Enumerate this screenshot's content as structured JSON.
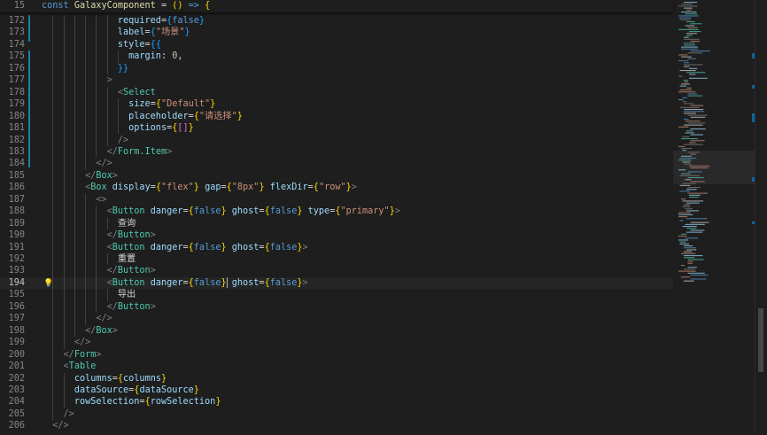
{
  "sticky": {
    "line_number": "15",
    "tokens": [
      {
        "t": "const ",
        "c": "t-kw"
      },
      {
        "t": "GalaxyComponent",
        "c": "t-fn"
      },
      {
        "t": " = ",
        "c": "t-txt"
      },
      {
        "t": "()",
        "c": "t-br1"
      },
      {
        "t": " ",
        "c": "t-txt"
      },
      {
        "t": "=>",
        "c": "t-kw"
      },
      {
        "t": " ",
        "c": "t-txt"
      },
      {
        "t": "{",
        "c": "t-br1"
      }
    ]
  },
  "editor": {
    "active_line": "194",
    "lines": [
      {
        "n": "172",
        "tokens": [
          {
            "t": "              ",
            "c": ""
          },
          {
            "t": "required",
            "c": "t-attr"
          },
          {
            "t": "=",
            "c": "t-txt"
          },
          {
            "t": "{",
            "c": "t-br2"
          },
          {
            "t": "false",
            "c": "t-kw"
          },
          {
            "t": "}",
            "c": "t-br2"
          }
        ]
      },
      {
        "n": "173",
        "tokens": [
          {
            "t": "              ",
            "c": ""
          },
          {
            "t": "label",
            "c": "t-attr"
          },
          {
            "t": "=",
            "c": "t-txt"
          },
          {
            "t": "{",
            "c": "t-br2"
          },
          {
            "t": "\"场景\"",
            "c": "t-str"
          },
          {
            "t": "}",
            "c": "t-br2"
          }
        ]
      },
      {
        "n": "174",
        "tokens": [
          {
            "t": "              ",
            "c": ""
          },
          {
            "t": "style",
            "c": "t-attr"
          },
          {
            "t": "=",
            "c": "t-txt"
          },
          {
            "t": "{{",
            "c": "t-br2"
          }
        ]
      },
      {
        "n": "175",
        "tokens": [
          {
            "t": "                ",
            "c": ""
          },
          {
            "t": "margin",
            "c": "t-attr"
          },
          {
            "t": ": ",
            "c": "t-txt"
          },
          {
            "t": "0",
            "c": "t-num"
          },
          {
            "t": ",",
            "c": "t-txt"
          }
        ]
      },
      {
        "n": "176",
        "tokens": [
          {
            "t": "              ",
            "c": ""
          },
          {
            "t": "}}",
            "c": "t-br2"
          }
        ]
      },
      {
        "n": "177",
        "tokens": [
          {
            "t": "            ",
            "c": ""
          },
          {
            "t": ">",
            "c": "t-pun"
          }
        ]
      },
      {
        "n": "178",
        "tokens": [
          {
            "t": "              ",
            "c": ""
          },
          {
            "t": "<",
            "c": "t-pun"
          },
          {
            "t": "Select",
            "c": "t-tag"
          }
        ]
      },
      {
        "n": "179",
        "tokens": [
          {
            "t": "                ",
            "c": ""
          },
          {
            "t": "size",
            "c": "t-attr"
          },
          {
            "t": "=",
            "c": "t-txt"
          },
          {
            "t": "{",
            "c": "t-br1"
          },
          {
            "t": "\"Default\"",
            "c": "t-str"
          },
          {
            "t": "}",
            "c": "t-br1"
          }
        ]
      },
      {
        "n": "180",
        "tokens": [
          {
            "t": "                ",
            "c": ""
          },
          {
            "t": "placeholder",
            "c": "t-attr"
          },
          {
            "t": "=",
            "c": "t-txt"
          },
          {
            "t": "{",
            "c": "t-br1"
          },
          {
            "t": "\"请选择\"",
            "c": "t-str"
          },
          {
            "t": "}",
            "c": "t-br1"
          }
        ]
      },
      {
        "n": "181",
        "tokens": [
          {
            "t": "                ",
            "c": ""
          },
          {
            "t": "options",
            "c": "t-attr"
          },
          {
            "t": "=",
            "c": "t-txt"
          },
          {
            "t": "{",
            "c": "t-br1"
          },
          {
            "t": "[]",
            "c": "t-brk"
          },
          {
            "t": "}",
            "c": "t-br1"
          }
        ]
      },
      {
        "n": "182",
        "tokens": [
          {
            "t": "              ",
            "c": ""
          },
          {
            "t": "/>",
            "c": "t-pun"
          }
        ]
      },
      {
        "n": "183",
        "tokens": [
          {
            "t": "            ",
            "c": ""
          },
          {
            "t": "</",
            "c": "t-pun"
          },
          {
            "t": "Form.Item",
            "c": "t-tag"
          },
          {
            "t": ">",
            "c": "t-pun"
          }
        ]
      },
      {
        "n": "184",
        "tokens": [
          {
            "t": "          ",
            "c": ""
          },
          {
            "t": "</>",
            "c": "t-pun"
          }
        ]
      },
      {
        "n": "185",
        "tokens": [
          {
            "t": "        ",
            "c": ""
          },
          {
            "t": "</",
            "c": "t-pun"
          },
          {
            "t": "Box",
            "c": "t-tag"
          },
          {
            "t": ">",
            "c": "t-pun"
          }
        ]
      },
      {
        "n": "186",
        "tokens": [
          {
            "t": "        ",
            "c": ""
          },
          {
            "t": "<",
            "c": "t-pun"
          },
          {
            "t": "Box",
            "c": "t-tag"
          },
          {
            "t": " ",
            "c": ""
          },
          {
            "t": "display",
            "c": "t-attr"
          },
          {
            "t": "=",
            "c": "t-txt"
          },
          {
            "t": "{",
            "c": "t-br1"
          },
          {
            "t": "\"flex\"",
            "c": "t-str"
          },
          {
            "t": "}",
            "c": "t-br1"
          },
          {
            "t": " ",
            "c": ""
          },
          {
            "t": "gap",
            "c": "t-attr"
          },
          {
            "t": "=",
            "c": "t-txt"
          },
          {
            "t": "{",
            "c": "t-br1"
          },
          {
            "t": "\"8px\"",
            "c": "t-str"
          },
          {
            "t": "}",
            "c": "t-br1"
          },
          {
            "t": " ",
            "c": ""
          },
          {
            "t": "flexDir",
            "c": "t-attr"
          },
          {
            "t": "=",
            "c": "t-txt"
          },
          {
            "t": "{",
            "c": "t-br1"
          },
          {
            "t": "\"row\"",
            "c": "t-str"
          },
          {
            "t": "}",
            "c": "t-br1"
          },
          {
            "t": ">",
            "c": "t-pun"
          }
        ]
      },
      {
        "n": "187",
        "tokens": [
          {
            "t": "          ",
            "c": ""
          },
          {
            "t": "<>",
            "c": "t-pun"
          }
        ]
      },
      {
        "n": "188",
        "tokens": [
          {
            "t": "            ",
            "c": ""
          },
          {
            "t": "<",
            "c": "t-pun"
          },
          {
            "t": "Button",
            "c": "t-tag"
          },
          {
            "t": " ",
            "c": ""
          },
          {
            "t": "danger",
            "c": "t-attr"
          },
          {
            "t": "=",
            "c": "t-txt"
          },
          {
            "t": "{",
            "c": "t-br1"
          },
          {
            "t": "false",
            "c": "t-kw"
          },
          {
            "t": "}",
            "c": "t-br1"
          },
          {
            "t": " ",
            "c": ""
          },
          {
            "t": "ghost",
            "c": "t-attr"
          },
          {
            "t": "=",
            "c": "t-txt"
          },
          {
            "t": "{",
            "c": "t-br1"
          },
          {
            "t": "false",
            "c": "t-kw"
          },
          {
            "t": "}",
            "c": "t-br1"
          },
          {
            "t": " ",
            "c": ""
          },
          {
            "t": "type",
            "c": "t-attr"
          },
          {
            "t": "=",
            "c": "t-txt"
          },
          {
            "t": "{",
            "c": "t-br1"
          },
          {
            "t": "\"primary\"",
            "c": "t-str"
          },
          {
            "t": "}",
            "c": "t-br1"
          },
          {
            "t": ">",
            "c": "t-pun"
          }
        ]
      },
      {
        "n": "189",
        "tokens": [
          {
            "t": "              ",
            "c": ""
          },
          {
            "t": "查询",
            "c": "t-txt"
          }
        ]
      },
      {
        "n": "190",
        "tokens": [
          {
            "t": "            ",
            "c": ""
          },
          {
            "t": "</",
            "c": "t-pun"
          },
          {
            "t": "Button",
            "c": "t-tag"
          },
          {
            "t": ">",
            "c": "t-pun"
          }
        ]
      },
      {
        "n": "191",
        "tokens": [
          {
            "t": "            ",
            "c": ""
          },
          {
            "t": "<",
            "c": "t-pun"
          },
          {
            "t": "Button",
            "c": "t-tag"
          },
          {
            "t": " ",
            "c": ""
          },
          {
            "t": "danger",
            "c": "t-attr"
          },
          {
            "t": "=",
            "c": "t-txt"
          },
          {
            "t": "{",
            "c": "t-br1"
          },
          {
            "t": "false",
            "c": "t-kw"
          },
          {
            "t": "}",
            "c": "t-br1"
          },
          {
            "t": " ",
            "c": ""
          },
          {
            "t": "ghost",
            "c": "t-attr"
          },
          {
            "t": "=",
            "c": "t-txt"
          },
          {
            "t": "{",
            "c": "t-br1"
          },
          {
            "t": "false",
            "c": "t-kw"
          },
          {
            "t": "}",
            "c": "t-br1"
          },
          {
            "t": ">",
            "c": "t-pun"
          }
        ]
      },
      {
        "n": "192",
        "tokens": [
          {
            "t": "              ",
            "c": ""
          },
          {
            "t": "重置",
            "c": "t-txt"
          }
        ]
      },
      {
        "n": "193",
        "tokens": [
          {
            "t": "            ",
            "c": ""
          },
          {
            "t": "</",
            "c": "t-pun"
          },
          {
            "t": "Button",
            "c": "t-tag"
          },
          {
            "t": ">",
            "c": "t-pun"
          }
        ]
      },
      {
        "n": "194",
        "tokens": [
          {
            "t": "            ",
            "c": ""
          },
          {
            "t": "<",
            "c": "t-pun"
          },
          {
            "t": "Button",
            "c": "t-tag"
          },
          {
            "t": " ",
            "c": ""
          },
          {
            "t": "danger",
            "c": "t-attr"
          },
          {
            "t": "=",
            "c": "t-txt"
          },
          {
            "t": "{",
            "c": "t-br1"
          },
          {
            "t": "false",
            "c": "t-kw"
          },
          {
            "t": "}",
            "c": "t-br1",
            "cursor": true
          },
          {
            "t": " ",
            "c": ""
          },
          {
            "t": "ghost",
            "c": "t-attr"
          },
          {
            "t": "=",
            "c": "t-txt"
          },
          {
            "t": "{",
            "c": "t-br1"
          },
          {
            "t": "false",
            "c": "t-kw"
          },
          {
            "t": "}",
            "c": "t-br1"
          },
          {
            "t": ">",
            "c": "t-pun"
          }
        ]
      },
      {
        "n": "195",
        "tokens": [
          {
            "t": "              ",
            "c": ""
          },
          {
            "t": "导出",
            "c": "t-txt"
          }
        ]
      },
      {
        "n": "196",
        "tokens": [
          {
            "t": "            ",
            "c": ""
          },
          {
            "t": "</",
            "c": "t-pun"
          },
          {
            "t": "Button",
            "c": "t-tag"
          },
          {
            "t": ">",
            "c": "t-pun"
          }
        ]
      },
      {
        "n": "197",
        "tokens": [
          {
            "t": "          ",
            "c": ""
          },
          {
            "t": "</>",
            "c": "t-pun"
          }
        ]
      },
      {
        "n": "198",
        "tokens": [
          {
            "t": "        ",
            "c": ""
          },
          {
            "t": "</",
            "c": "t-pun"
          },
          {
            "t": "Box",
            "c": "t-tag"
          },
          {
            "t": ">",
            "c": "t-pun"
          }
        ]
      },
      {
        "n": "199",
        "tokens": [
          {
            "t": "      ",
            "c": ""
          },
          {
            "t": "</>",
            "c": "t-pun"
          }
        ]
      },
      {
        "n": "200",
        "tokens": [
          {
            "t": "    ",
            "c": ""
          },
          {
            "t": "</",
            "c": "t-pun"
          },
          {
            "t": "Form",
            "c": "t-tag"
          },
          {
            "t": ">",
            "c": "t-pun"
          }
        ]
      },
      {
        "n": "201",
        "tokens": [
          {
            "t": "    ",
            "c": ""
          },
          {
            "t": "<",
            "c": "t-pun"
          },
          {
            "t": "Table",
            "c": "t-tag"
          }
        ]
      },
      {
        "n": "202",
        "tokens": [
          {
            "t": "      ",
            "c": ""
          },
          {
            "t": "columns",
            "c": "t-attr"
          },
          {
            "t": "=",
            "c": "t-txt"
          },
          {
            "t": "{",
            "c": "t-br1"
          },
          {
            "t": "columns",
            "c": "t-attr"
          },
          {
            "t": "}",
            "c": "t-br1"
          }
        ]
      },
      {
        "n": "203",
        "tokens": [
          {
            "t": "      ",
            "c": ""
          },
          {
            "t": "dataSource",
            "c": "t-attr"
          },
          {
            "t": "=",
            "c": "t-txt"
          },
          {
            "t": "{",
            "c": "t-br1"
          },
          {
            "t": "dataSource",
            "c": "t-attr"
          },
          {
            "t": "}",
            "c": "t-br1"
          }
        ]
      },
      {
        "n": "204",
        "tokens": [
          {
            "t": "      ",
            "c": ""
          },
          {
            "t": "rowSelection",
            "c": "t-attr"
          },
          {
            "t": "=",
            "c": "t-txt"
          },
          {
            "t": "{",
            "c": "t-br1"
          },
          {
            "t": "rowSelection",
            "c": "t-attr"
          },
          {
            "t": "}",
            "c": "t-br1"
          }
        ]
      },
      {
        "n": "205",
        "tokens": [
          {
            "t": "    ",
            "c": ""
          },
          {
            "t": "/>",
            "c": "t-pun"
          }
        ]
      },
      {
        "n": "206",
        "tokens": [
          {
            "t": "  ",
            "c": ""
          },
          {
            "t": "</>",
            "c": "t-pun"
          }
        ]
      }
    ]
  },
  "minimap": {
    "icon": "minimap",
    "accent": "#0e639c"
  },
  "scrollbar": {
    "icon": "vertical-scrollbar"
  },
  "gutter": {
    "lightbulb_icon": "lightbulb-icon",
    "modified_color": "#1b81a8"
  }
}
